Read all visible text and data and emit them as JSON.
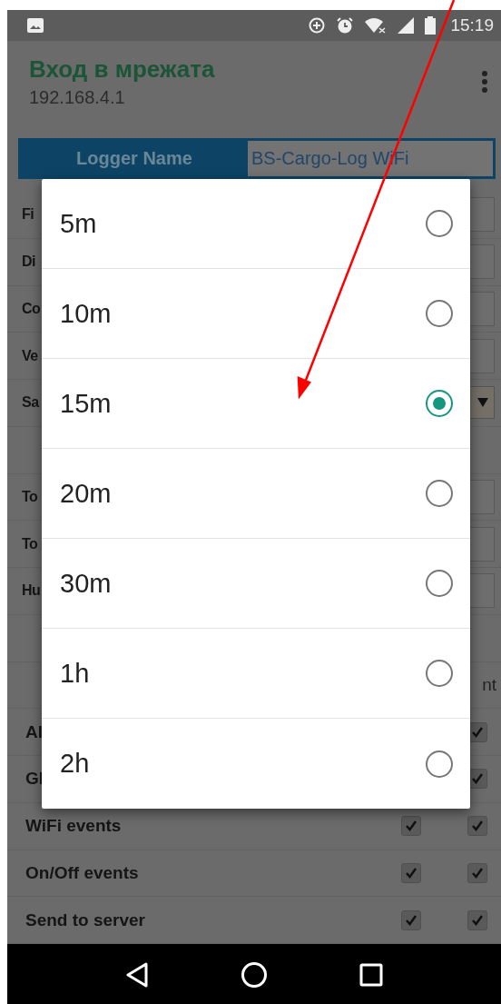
{
  "status_bar": {
    "time": "15:19"
  },
  "app_bar": {
    "title": "Вход в мрежата",
    "subtitle": "192.168.4.1"
  },
  "header_row": {
    "label": "Logger Name",
    "value": "BS-Cargo-Log WiFi"
  },
  "rows": [
    {
      "kind": "field",
      "label": "Fi"
    },
    {
      "kind": "field",
      "label": "Di"
    },
    {
      "kind": "field",
      "label": "Co"
    },
    {
      "kind": "field",
      "label": "Ve"
    },
    {
      "kind": "select",
      "label": "Sa"
    },
    {
      "kind": "blank"
    },
    {
      "kind": "field",
      "label": "To"
    },
    {
      "kind": "field",
      "label": "To"
    },
    {
      "kind": "field",
      "label": "Hu"
    },
    {
      "kind": "blank"
    },
    {
      "kind": "heading",
      "text": "nt"
    },
    {
      "kind": "checks",
      "label": "Al",
      "checks": [
        {
          "checked": true
        }
      ]
    },
    {
      "kind": "checks",
      "label": "Gl",
      "checks": [
        {
          "checked": true
        }
      ]
    },
    {
      "kind": "checks",
      "label": "WiFi events",
      "checks": [
        {
          "checked": true
        },
        {
          "checked": true
        }
      ]
    },
    {
      "kind": "checks",
      "label": "On/Off events",
      "checks": [
        {
          "checked": true
        },
        {
          "checked": true
        }
      ]
    },
    {
      "kind": "checks",
      "label": "Send to server",
      "checks": [
        {
          "checked": true
        },
        {
          "checked": true
        }
      ]
    }
  ],
  "dialog": {
    "options": [
      {
        "label": "5m",
        "selected": false
      },
      {
        "label": "10m",
        "selected": false
      },
      {
        "label": "15m",
        "selected": true
      },
      {
        "label": "20m",
        "selected": false
      },
      {
        "label": "30m",
        "selected": false
      },
      {
        "label": "1h",
        "selected": false
      },
      {
        "label": "2h",
        "selected": false
      }
    ]
  }
}
